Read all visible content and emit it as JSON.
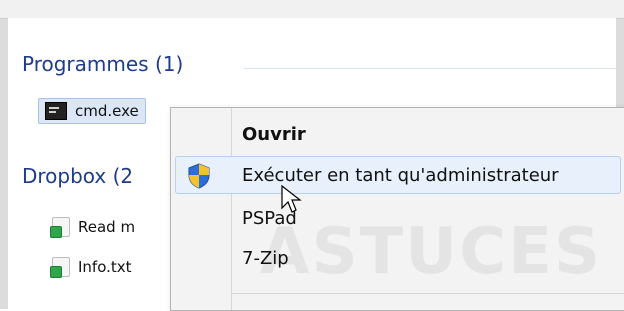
{
  "search_results": {
    "groups": [
      {
        "title": "Programmes (1)",
        "items": [
          {
            "label": "cmd.exe",
            "icon": "cmd-icon",
            "selected": true
          }
        ]
      },
      {
        "title": "Dropbox (2",
        "items": [
          {
            "label": "Read m",
            "icon": "text-file-icon"
          },
          {
            "label": "Info.txt",
            "icon": "text-file-icon"
          }
        ]
      }
    ]
  },
  "context_menu": {
    "items": [
      {
        "label": "Ouvrir",
        "bold": true
      },
      {
        "label": "Exécuter en tant qu'administrateur",
        "icon": "shield-icon",
        "highlighted": true
      },
      {
        "label": "PSPad"
      },
      {
        "label": "7-Zip"
      }
    ]
  },
  "watermark": {
    "text": "ASTUCES"
  },
  "colors": {
    "group_header": "#1e3b8c",
    "selection_bg": "#dbe7f6",
    "menu_bg": "#f3f3f3",
    "menu_hover_bg": "#e7f0fb"
  }
}
